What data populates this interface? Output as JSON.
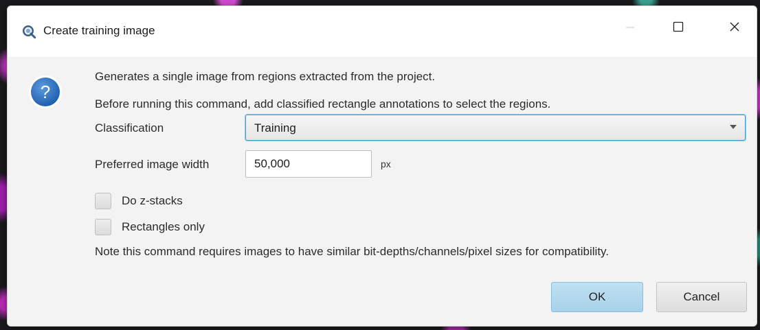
{
  "window": {
    "title": "Create training image",
    "app_icon": "qupath-logo-icon",
    "controls": {
      "minimize_icon": "minimize-icon",
      "maximize_icon": "maximize-icon",
      "close_icon": "close-icon"
    }
  },
  "dialog": {
    "icon": "help-question-icon",
    "description_line1": "Generates a single image from regions extracted from the project.",
    "description_line2": "Before running this command, add classified rectangle annotations to select the regions.",
    "classification_label": "Classification",
    "classification_value": "Training",
    "width_label": "Preferred image width",
    "width_value": "50,000",
    "width_unit": "px",
    "checkboxes": [
      {
        "label": "Do z-stacks",
        "checked": false
      },
      {
        "label": "Rectangles only",
        "checked": false
      }
    ],
    "note": "Note this command requires images to have similar bit-depths/channels/pixel sizes for compatibility.",
    "ok_label": "OK",
    "cancel_label": "Cancel"
  },
  "colors": {
    "accent": "#3aa1cf",
    "ok_button": "#a8d2ea",
    "help_icon": "#2c6fc0"
  }
}
